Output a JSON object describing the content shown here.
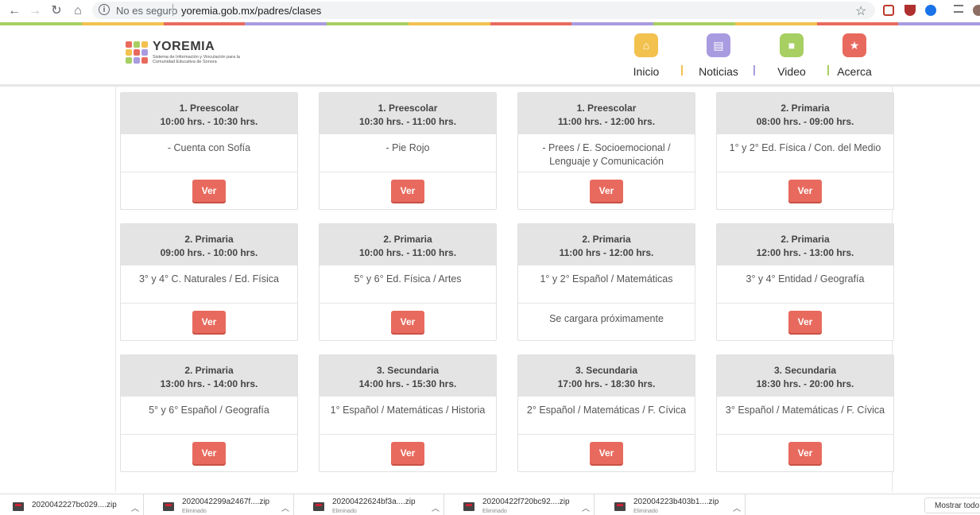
{
  "browser": {
    "security_label": "No es seguro",
    "url": "yoremia.gob.mx/padres/clases",
    "info_icon": "info-icon",
    "star_icon": "star-icon"
  },
  "brand": {
    "name": "YOREMIA",
    "tagline": "Sistema de Información y Vinculación para la Comunidad Educativa de Sonora"
  },
  "menu": [
    {
      "label": "Inicio",
      "icon": "home-icon",
      "color": "#f2c14e"
    },
    {
      "label": "Noticias",
      "icon": "news-icon",
      "color": "#a99be0"
    },
    {
      "label": "Video",
      "icon": "video-icon",
      "color": "#a7cf62"
    },
    {
      "label": "Acerca",
      "icon": "star-icon",
      "color": "#e86a5e"
    }
  ],
  "button_label": "Ver",
  "coming_soon": "Se cargara próximamente",
  "classes": [
    {
      "level": "1. Preescolar",
      "time": "10:00 hrs. - 10:30 hrs.",
      "subject": "- Cuenta con Sofía",
      "available": true
    },
    {
      "level": "1. Preescolar",
      "time": "10:30 hrs. - 11:00 hrs.",
      "subject": "- Pie Rojo",
      "available": true
    },
    {
      "level": "1. Preescolar",
      "time": "11:00 hrs. - 12:00 hrs.",
      "subject": "- Prees / E. Socioemocional / Lenguaje y Comunicación",
      "available": true
    },
    {
      "level": "2. Primaria",
      "time": "08:00 hrs. - 09:00 hrs.",
      "subject": "1° y 2° Ed. Física / Con. del Medio",
      "available": true
    },
    {
      "level": "2. Primaria",
      "time": "09:00 hrs. - 10:00 hrs.",
      "subject": "3° y 4° C. Naturales / Ed. Física",
      "available": true
    },
    {
      "level": "2. Primaria",
      "time": "10:00 hrs. - 11:00 hrs.",
      "subject": "5° y 6° Ed. Física / Artes",
      "available": true
    },
    {
      "level": "2. Primaria",
      "time": "11:00 hrs - 12:00 hrs.",
      "subject": "1° y 2° Español / Matemáticas",
      "available": false
    },
    {
      "level": "2. Primaria",
      "time": "12:00 hrs. - 13:00 hrs.",
      "subject": "3° y 4° Entidad / Geografía",
      "available": true
    },
    {
      "level": "2. Primaria",
      "time": "13:00 hrs. - 14:00 hrs.",
      "subject": "5° y 6° Español / Geografía",
      "available": true
    },
    {
      "level": "3. Secundaria",
      "time": "14:00 hrs. - 15:30 hrs.",
      "subject": "1° Español / Matemáticas / Historia",
      "available": true
    },
    {
      "level": "3. Secundaria",
      "time": "17:00 hrs. - 18:30 hrs.",
      "subject": "2° Español / Matemáticas / F. Cívica",
      "available": true
    },
    {
      "level": "3. Secundaria",
      "time": "18:30 hrs. - 20:00 hrs.",
      "subject": "3° Español / Matemáticas / F. Cívica",
      "available": true
    }
  ],
  "downloads": [
    {
      "name": "2020042227bc029....zip",
      "status": ""
    },
    {
      "name": "2020042299a2467f....zip",
      "status": "Eliminado"
    },
    {
      "name": "20200422624bf3a....zip",
      "status": "Eliminado"
    },
    {
      "name": "20200422f720bc92....zip",
      "status": "Eliminado"
    },
    {
      "name": "202004223b403b1....zip",
      "status": "Eliminado"
    }
  ],
  "show_all_label": "Mostrar todo",
  "colors": {
    "accent_red": "#e86a5e",
    "card_header": "#e4e4e4"
  }
}
